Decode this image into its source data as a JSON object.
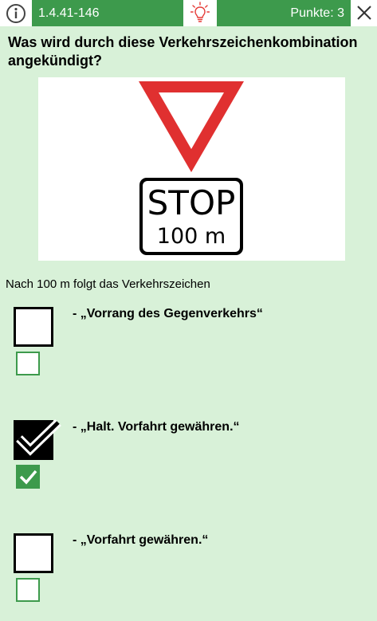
{
  "header": {
    "code": "1.4.41-146",
    "points": "Punkte: 3"
  },
  "question": {
    "text": "Was wird durch diese Verkehrszeichenkombination angekündigt?"
  },
  "sign": {
    "plate_line1": "STOP",
    "plate_line2": "100 m"
  },
  "subtext": "Nach 100 m folgt das Verkehrszeichen",
  "answers": [
    {
      "label": "- „Vorrang des Gegenverkehrs“",
      "selected": false,
      "correct": false
    },
    {
      "label": "- „Halt. Vorfahrt gewähren.“",
      "selected": true,
      "correct": true
    },
    {
      "label": "- „Vorfahrt gewähren.“",
      "selected": false,
      "correct": false
    }
  ],
  "colors": {
    "background": "#d8f1d8",
    "accent_green": "#3d9a4c",
    "sign_red": "#e03030",
    "hint_red": "#e53935"
  }
}
